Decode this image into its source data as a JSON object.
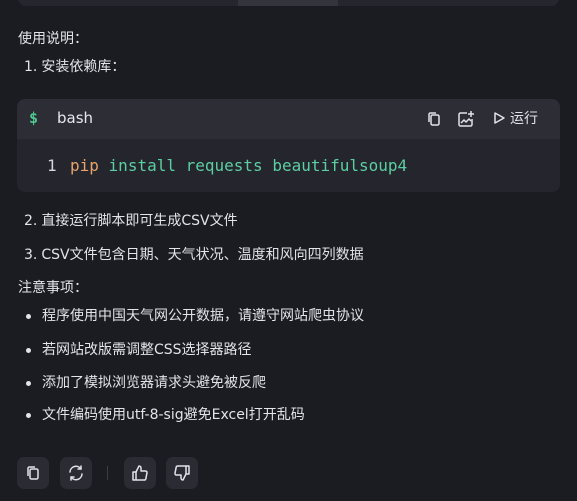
{
  "usage": {
    "heading": "使用说明：",
    "steps": [
      {
        "num": "1.",
        "text": "安装依赖库："
      },
      {
        "num": "2.",
        "text": "直接运行脚本即可生成CSV文件"
      },
      {
        "num": "3.",
        "text": "CSV文件包含日期、天气状况、温度和风向四列数据"
      }
    ]
  },
  "code_block": {
    "prompt_symbol": "$",
    "language": "bash",
    "run_label": "运行",
    "line_number": "1",
    "tokens": {
      "cmd": "pip",
      "sub": "install",
      "args": "requests beautifulsoup4"
    },
    "icons": [
      "copy-icon",
      "insert-icon",
      "play-icon"
    ]
  },
  "notes": {
    "heading": "注意事项：",
    "items": [
      "程序使用中国天气网公开数据，请遵守网站爬虫协议",
      "若网站改版需调整CSS选择器路径",
      "添加了模拟浏览器请求头避免被反爬",
      "文件编码使用utf-8-sig避免Excel打开乱码"
    ]
  },
  "actions": {
    "icons": [
      "copy-icon",
      "regenerate-icon",
      "thumbs-up-icon",
      "thumbs-down-icon"
    ]
  },
  "colors": {
    "background": "#1b1c21",
    "code_bg": "#24252d",
    "code_header_bg": "#2c2d35",
    "prompt_green": "#4ec990",
    "keyword_orange": "#e8a36b",
    "function_green": "#5ccfa1"
  }
}
